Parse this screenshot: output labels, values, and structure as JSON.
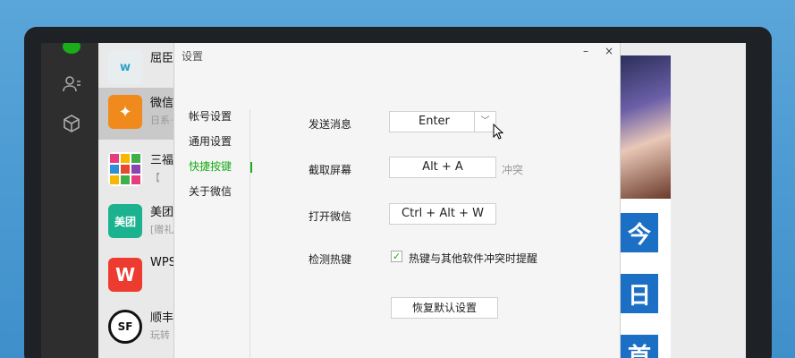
{
  "chats": [
    {
      "name": "屈臣",
      "sub": "",
      "logo_text": "w",
      "logo_color": "#e8eef0",
      "active": false
    },
    {
      "name": "微信",
      "sub": "日系·",
      "logo_text": "✦",
      "logo_color": "#f08a1c",
      "active": true
    },
    {
      "name": "三福",
      "sub": "【",
      "logo_text": "",
      "logo_color": "#ffffff",
      "active": false
    },
    {
      "name": "美团",
      "sub": "[赠礼",
      "logo_text": "美团",
      "logo_color": "#1bb38f",
      "active": false
    },
    {
      "name": "WPS",
      "sub": "",
      "logo_text": "W",
      "logo_color": "#ee3b2f",
      "active": false
    },
    {
      "name": "顺丰",
      "sub": "玩转",
      "logo_text": "SF",
      "logo_color": "#111111",
      "active": false
    }
  ],
  "dialog": {
    "title": "设置",
    "minimize": "–",
    "close": "×",
    "menu": [
      {
        "label": "帐号设置",
        "active": false
      },
      {
        "label": "通用设置",
        "active": false
      },
      {
        "label": "快捷按键",
        "active": true
      },
      {
        "label": "关于微信",
        "active": false
      }
    ],
    "rows": {
      "send_label": "发送消息",
      "send_value": "Enter",
      "screenshot_label": "截取屏幕",
      "screenshot_value": "Alt + A",
      "screenshot_conflict": "冲突",
      "open_label": "打开微信",
      "open_value": "Ctrl + Alt + W",
      "detect_label": "检测热键",
      "detect_checkbox_label": "热键与其他软件冲突时提醒",
      "detect_checked": true,
      "reset_label": "恢复默认设置"
    }
  },
  "behind": {
    "blocks": [
      "今",
      "日",
      "首"
    ]
  },
  "colors": {
    "accent": "#1aad19",
    "nav_bg": "#2e2e2e"
  }
}
